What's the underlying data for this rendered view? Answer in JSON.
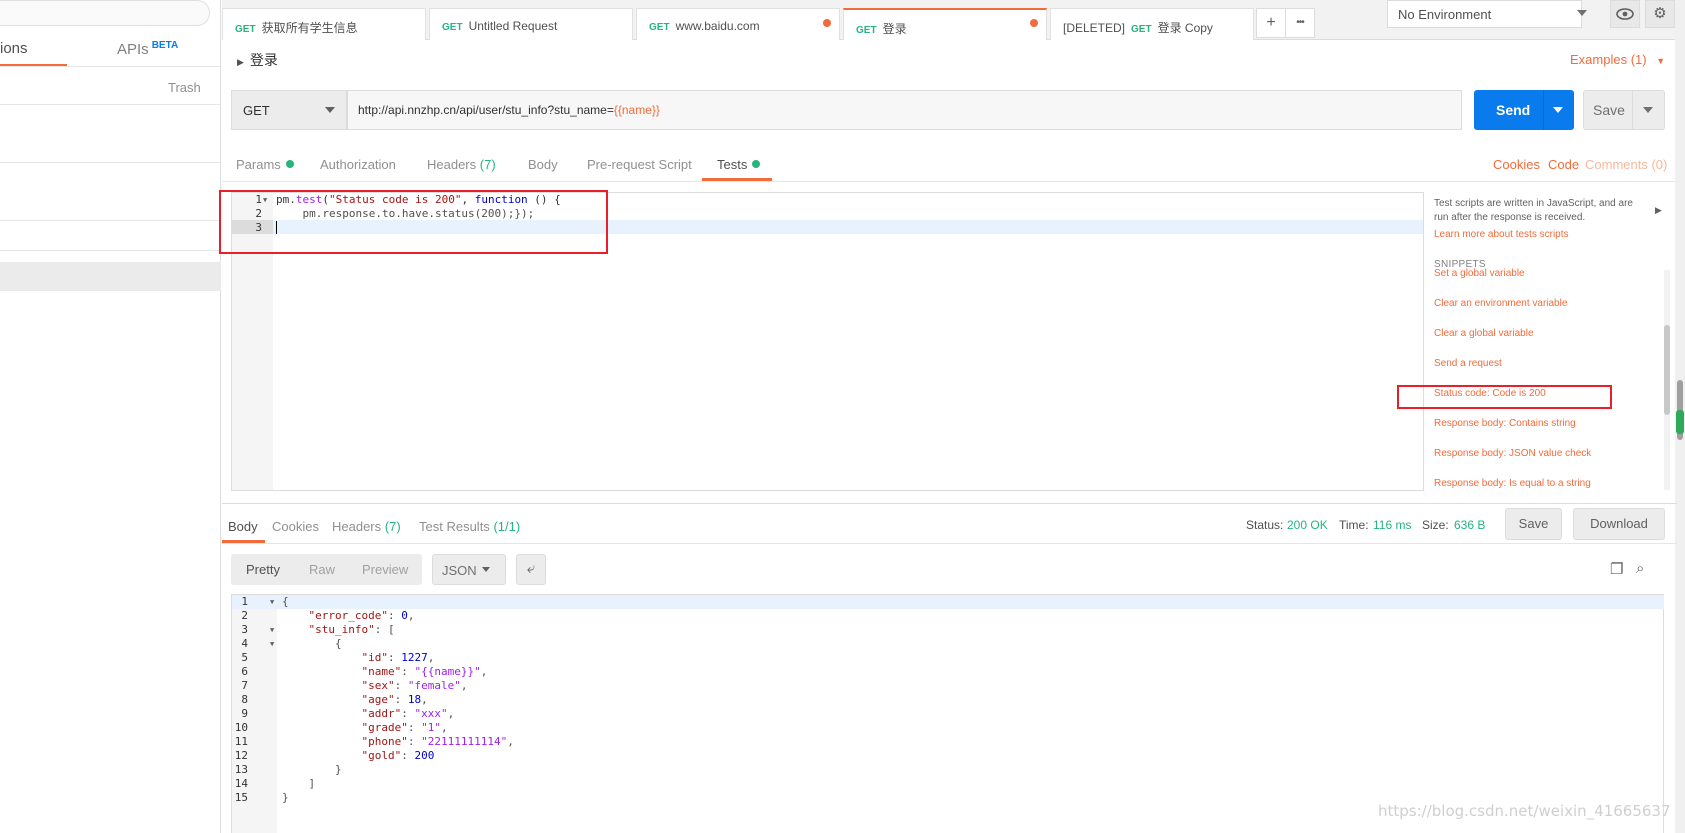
{
  "sidebar": {
    "tabs": [
      {
        "label": "ions"
      },
      {
        "label": "APIs",
        "badge": "BETA"
      }
    ],
    "trash_label": "Trash"
  },
  "tabs": [
    {
      "method": "GET",
      "title": "获取所有学生信息",
      "unsaved": false,
      "active": false
    },
    {
      "method": "GET",
      "title": "Untitled Request",
      "unsaved": false,
      "active": false
    },
    {
      "method": "GET",
      "title": "www.baidu.com",
      "unsaved": true,
      "active": false
    },
    {
      "method": "GET",
      "title": "登录",
      "unsaved": true,
      "active": true
    },
    {
      "prefix": "[DELETED]",
      "method": "GET",
      "title": "登录 Copy",
      "unsaved": false,
      "active": false
    }
  ],
  "tab_actions": {
    "add": "+",
    "more": "•••"
  },
  "environment": {
    "selected": "No Environment"
  },
  "icons": {
    "eye": "eye-icon",
    "settings": "gear-icon"
  },
  "request": {
    "name": "登录",
    "examples_label": "Examples (1)",
    "method": "GET",
    "url_base": "http://api.nnzhp.cn/api/user/stu_info?stu_name=",
    "url_var": "{{name}}",
    "send_label": "Send",
    "save_label": "Save"
  },
  "request_tabs": {
    "params": "Params",
    "authorization": "Authorization",
    "headers": "Headers",
    "headers_count": "(7)",
    "body": "Body",
    "prerequest": "Pre-request Script",
    "tests": "Tests",
    "cookies": "Cookies",
    "code": "Code",
    "comments": "Comments (0)"
  },
  "tests_editor": {
    "line_numbers": [
      "1",
      "2",
      "3"
    ],
    "line1_a": "pm.",
    "line1_b": "test",
    "line1_c": "(",
    "line1_d": "\"Status code is 200\"",
    "line1_e": ", ",
    "line1_f": "function",
    "line1_g": " () {",
    "line2": "    pm.response.to.have.status(200);});",
    "line3": ""
  },
  "snippets": {
    "description": "Test scripts are written in JavaScript, and are run after the response is received.",
    "learn_more": "Learn more about tests scripts",
    "heading": "SNIPPETS",
    "items": [
      "Set a global variable",
      "Clear an environment variable",
      "Clear a global variable",
      "Send a request",
      "Status code: Code is 200",
      "Response body: Contains string",
      "Response body: JSON value check",
      "Response body: Is equal to a string"
    ]
  },
  "response": {
    "tabs": {
      "body": "Body",
      "cookies": "Cookies",
      "headers": "Headers",
      "headers_count": "(7)",
      "test_results": "Test Results",
      "test_results_count": "(1/1)"
    },
    "status_label": "Status:",
    "status_value": "200 OK",
    "time_label": "Time:",
    "time_value": "116 ms",
    "size_label": "Size:",
    "size_value": "636 B",
    "save_label": "Save",
    "download_label": "Download",
    "views": [
      "Pretty",
      "Raw",
      "Preview"
    ],
    "format": "JSON",
    "body_lines": [
      "{",
      "    \"error_code\": 0,",
      "    \"stu_info\": [",
      "        {",
      "            \"id\": 1227,",
      "            \"name\": \"{{name}}\",",
      "            \"sex\": \"female\",",
      "            \"age\": 18,",
      "            \"addr\": \"xxx\",",
      "            \"grade\": \"1\",",
      "            \"phone\": \"22111111114\",",
      "            \"gold\": 200",
      "        }",
      "    ]",
      "}"
    ],
    "body_line_numbers": [
      "1",
      "2",
      "3",
      "4",
      "5",
      "6",
      "7",
      "8",
      "9",
      "10",
      "11",
      "12",
      "13",
      "14",
      "15"
    ]
  },
  "watermark": "https://blog.csdn.net/weixin_41665637",
  "colors": {
    "accent": "#f26b3a",
    "send": "#097bed",
    "method_get": "#26b47f",
    "annotation": "#e8202a"
  }
}
